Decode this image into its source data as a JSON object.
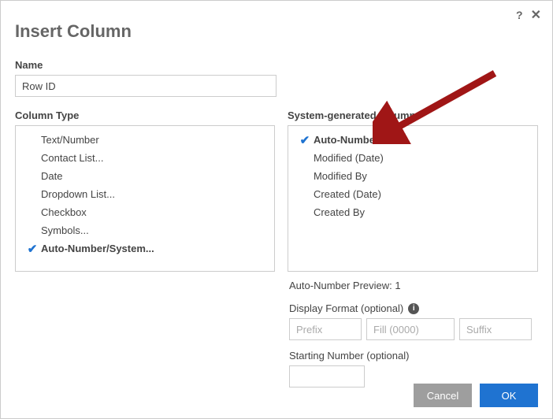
{
  "dialog": {
    "title": "Insert Column",
    "name_label": "Name",
    "name_value": "Row ID",
    "column_type_label": "Column Type",
    "sys_col_label": "System-generated column"
  },
  "column_types": [
    {
      "label": "Text/Number",
      "selected": false
    },
    {
      "label": "Contact List...",
      "selected": false
    },
    {
      "label": "Date",
      "selected": false
    },
    {
      "label": "Dropdown List...",
      "selected": false
    },
    {
      "label": "Checkbox",
      "selected": false
    },
    {
      "label": "Symbols...",
      "selected": false
    },
    {
      "label": "Auto-Number/System...",
      "selected": true
    }
  ],
  "sys_columns": [
    {
      "label": "Auto-Number",
      "selected": true
    },
    {
      "label": "Modified (Date)",
      "selected": false
    },
    {
      "label": "Modified By",
      "selected": false
    },
    {
      "label": "Created (Date)",
      "selected": false
    },
    {
      "label": "Created By",
      "selected": false
    }
  ],
  "preview": {
    "label_prefix": "Auto-Number Preview: ",
    "value": "1"
  },
  "display_format": {
    "label": "Display Format (optional)",
    "prefix_placeholder": "Prefix",
    "fill_placeholder": "Fill (0000)",
    "suffix_placeholder": "Suffix"
  },
  "starting_number": {
    "label": "Starting Number (optional)",
    "value": ""
  },
  "buttons": {
    "cancel": "Cancel",
    "ok": "OK"
  },
  "colors": {
    "accent": "#1f73d1",
    "arrow": "#a01616"
  }
}
